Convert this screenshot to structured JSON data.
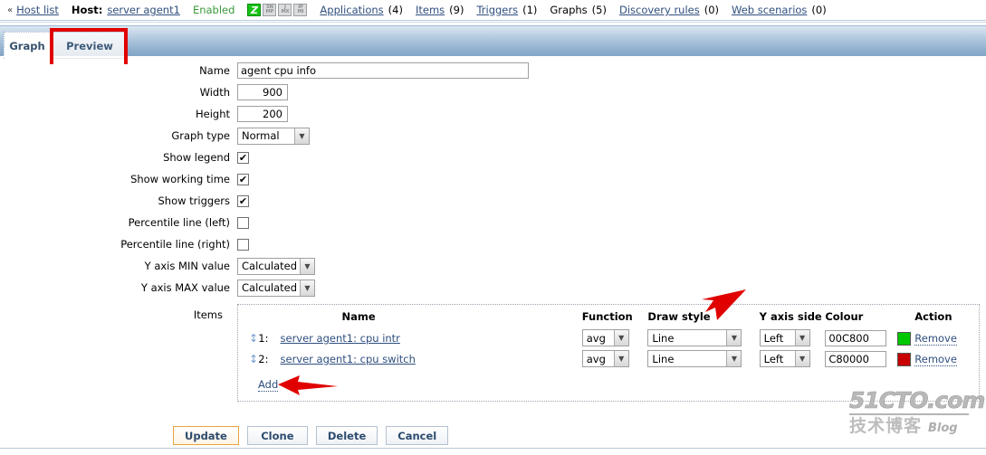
{
  "topnav": {
    "back_chevron": "«",
    "host_list_link": "Host list",
    "host_label": "Host:",
    "host_name": "server agent1",
    "status": "Enabled",
    "badges": [
      {
        "name": "zabbix-agent-badge",
        "text": "Z",
        "active": true
      },
      {
        "name": "snmp-badge",
        "line1": "SN",
        "line2": "MP",
        "active": false
      },
      {
        "name": "jmx-badge",
        "line1": "J",
        "line2": "MX",
        "active": false
      },
      {
        "name": "ipmi-badge",
        "line1": "IP",
        "line2": "MI",
        "active": false
      }
    ],
    "links": [
      {
        "label": "Applications",
        "count": "(4)",
        "link": true
      },
      {
        "label": "Items",
        "count": "(9)",
        "link": true
      },
      {
        "label": "Triggers",
        "count": "(1)",
        "link": true
      },
      {
        "label": "Graphs",
        "count": "(5)",
        "link": false
      },
      {
        "label": "Discovery rules",
        "count": "(0)",
        "link": true
      },
      {
        "label": "Web scenarios",
        "count": "(0)",
        "link": true
      }
    ]
  },
  "tabs": {
    "graph": "Graph",
    "preview": "Preview"
  },
  "form": {
    "name": {
      "label": "Name",
      "value": "agent cpu info"
    },
    "width": {
      "label": "Width",
      "value": "900"
    },
    "height": {
      "label": "Height",
      "value": "200"
    },
    "graph_type": {
      "label": "Graph type",
      "value": "Normal"
    },
    "show_legend": {
      "label": "Show legend",
      "checked": true,
      "mark": "✔"
    },
    "show_working_time": {
      "label": "Show working time",
      "checked": true,
      "mark": "✔"
    },
    "show_triggers": {
      "label": "Show triggers",
      "checked": true,
      "mark": "✔"
    },
    "percentile_left": {
      "label": "Percentile line (left)",
      "checked": false,
      "mark": ""
    },
    "percentile_right": {
      "label": "Percentile line (right)",
      "checked": false,
      "mark": ""
    },
    "y_axis_min": {
      "label": "Y axis MIN value",
      "value": "Calculated"
    },
    "y_axis_max": {
      "label": "Y axis MAX value",
      "value": "Calculated"
    },
    "items_label": "Items"
  },
  "items": {
    "headers": {
      "name": "Name",
      "function": "Function",
      "draw_style": "Draw style",
      "y_axis_side": "Y axis side",
      "colour": "Colour",
      "action": "Action"
    },
    "rows": [
      {
        "index": "1:",
        "name": "server agent1: cpu intr",
        "function": "avg",
        "draw_style": "Line",
        "y_axis_side": "Left",
        "colour": "00C800",
        "swatch": "#00C800",
        "action": "Remove"
      },
      {
        "index": "2:",
        "name": "server agent1: cpu switch",
        "function": "avg",
        "draw_style": "Line",
        "y_axis_side": "Left",
        "colour": "C80000",
        "swatch": "#C80000",
        "action": "Remove"
      }
    ],
    "add_label": "Add"
  },
  "footer": {
    "update": "Update",
    "clone": "Clone",
    "delete": "Delete",
    "cancel": "Cancel"
  },
  "watermark": {
    "site": "51CTO.com",
    "cn": "技术博客",
    "blog": "Blog"
  },
  "colors": {
    "link": "#2f4f7f",
    "enabled": "#3a9a3a",
    "annotation_red": "#e00000",
    "tab_blue": "#8fafcd"
  }
}
